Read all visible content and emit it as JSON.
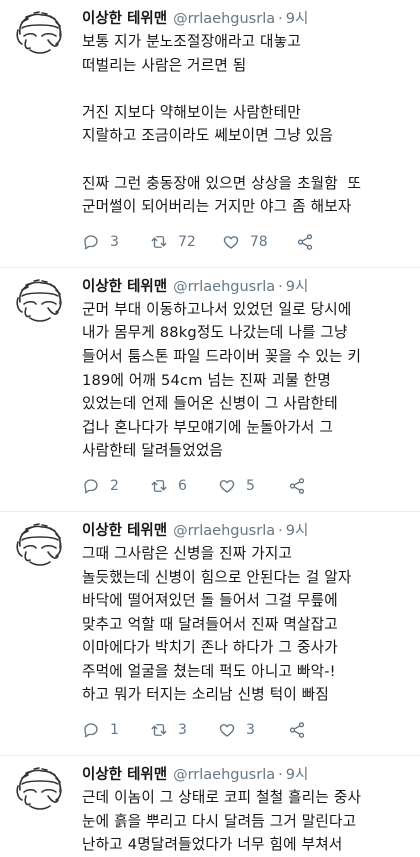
{
  "tweets": [
    {
      "name": "이상한 테위맨",
      "handle": "@rrlaehgusrla",
      "separator": "·",
      "time": "9시",
      "text": "보통 지가 분노조절장애라고 대놓고\n떠벌리는 사람은 거르면 됨\n\n거진 지보다 약해보이는 사람한테만\n지랄하고 조금이라도 쎄보이면 그냥 있음\n\n진짜 그런 충동장애 있으면 상상을 초월함  또\n군머썰이 되어버리는 거지만 야그 좀 해보자",
      "replies": "3",
      "retweets": "72",
      "likes": "78"
    },
    {
      "name": "이상한 테위맨",
      "handle": "@rrlaehgusrla",
      "separator": "·",
      "time": "9시",
      "text": "군머 부대 이동하고나서 있었던 일로 당시에\n내가 몸무게 88kg정도 나갔는데 나를 그냥\n들어서 툼스톤 파일 드라이버 꽂을 수 있는 키\n189에 어깨 54cm 넘는 진짜 괴물 한명\n있었는데 언제 들어온 신병이 그 사람한테\n겁나 혼나다가 부모얘기에 눈돌아가서 그\n사람한테 달려들었었음",
      "replies": "2",
      "retweets": "6",
      "likes": "5"
    },
    {
      "name": "이상한 테위맨",
      "handle": "@rrlaehgusrla",
      "separator": "·",
      "time": "9시",
      "text": "그때 그사람은 신병을 진짜 가지고\n놀듯했는데 신병이 힘으로 안된다는 걸 알자\n바닥에 떨어져있던 돌 들어서 그걸 무릎에\n맞추고 억할 때 달려들어서 진짜 멱살잡고\n이마에다가 박치기 존나 하다가 그 중사가\n주먹에 얼굴을 쳤는데 퍽도 아니고 빠악-!\n하고 뭐가 터지는 소리남 신병 턱이 빠짐",
      "replies": "1",
      "retweets": "3",
      "likes": "3"
    },
    {
      "name": "이상한 테위맨",
      "handle": "@rrlaehgusrla",
      "separator": "·",
      "time": "9시",
      "text": "근데 이놈이 그 상태로 코피 철철 흘리는 중사\n눈에 흙을 뿌리고 다시 달려듬 그거 말린다고\n난하고 4명달려들었다가 너무 힘에 부쳐서",
      "replies": "",
      "retweets": "",
      "likes": ""
    }
  ]
}
